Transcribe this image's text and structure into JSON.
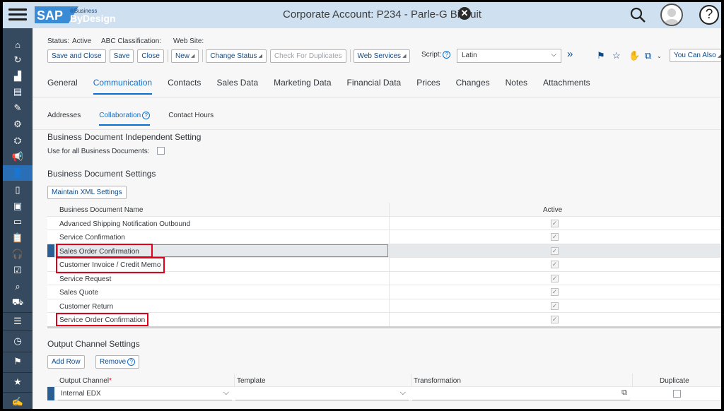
{
  "shell": {
    "logo_main": "SAP",
    "logo_sub1": "Business",
    "logo_sub2": "ByDesign",
    "title": "Corporate Account: P234 - Parle-G Biscuit"
  },
  "status": {
    "status_label": "Status:",
    "status_value": "Active",
    "abc_label": "ABC Classification:",
    "website_label": "Web Site:"
  },
  "toolbar": {
    "save_close": "Save and Close",
    "save": "Save",
    "close": "Close",
    "new": "New",
    "change_status": "Change Status",
    "check_duplicates": "Check For Duplicates",
    "web_services": "Web Services",
    "script_label": "Script:",
    "script_value": "Latin",
    "you_can_also": "You Can Also"
  },
  "tabs": [
    "General",
    "Communication",
    "Contacts",
    "Sales Data",
    "Marketing Data",
    "Financial Data",
    "Prices",
    "Changes",
    "Notes",
    "Attachments"
  ],
  "subtabs": [
    "Addresses",
    "Collaboration",
    "Contact Hours"
  ],
  "independent": {
    "title": "Business Document Independent Setting",
    "use_all_label": "Use for all Business Documents:"
  },
  "doc_settings": {
    "title": "Business Document Settings",
    "maintain_xml": "Maintain XML Settings",
    "col_name": "Business Document Name",
    "col_active": "Active",
    "rows": [
      {
        "name": "Advanced Shipping Notification Outbound",
        "active": true
      },
      {
        "name": "Service Confirmation",
        "active": true
      },
      {
        "name": "Sales Order Confirmation",
        "active": true
      },
      {
        "name": "Customer Invoice / Credit Memo",
        "active": true
      },
      {
        "name": "Service Request",
        "active": true
      },
      {
        "name": "Sales Quote",
        "active": true
      },
      {
        "name": "Customer Return",
        "active": true
      },
      {
        "name": "Service Order Confirmation",
        "active": true
      }
    ]
  },
  "output": {
    "title": "Output Channel Settings",
    "add_row": "Add Row",
    "remove": "Remove",
    "col_channel": "Output Channel",
    "col_template": "Template",
    "col_transformation": "Transformation",
    "col_duplicate": "Duplicate",
    "row_channel": "Internal EDX"
  },
  "colors": {
    "shell_bg": "#cfe0f1",
    "sidebar_bg": "#354a5f",
    "accent": "#0a6ed1",
    "highlight": "#e3001b"
  }
}
